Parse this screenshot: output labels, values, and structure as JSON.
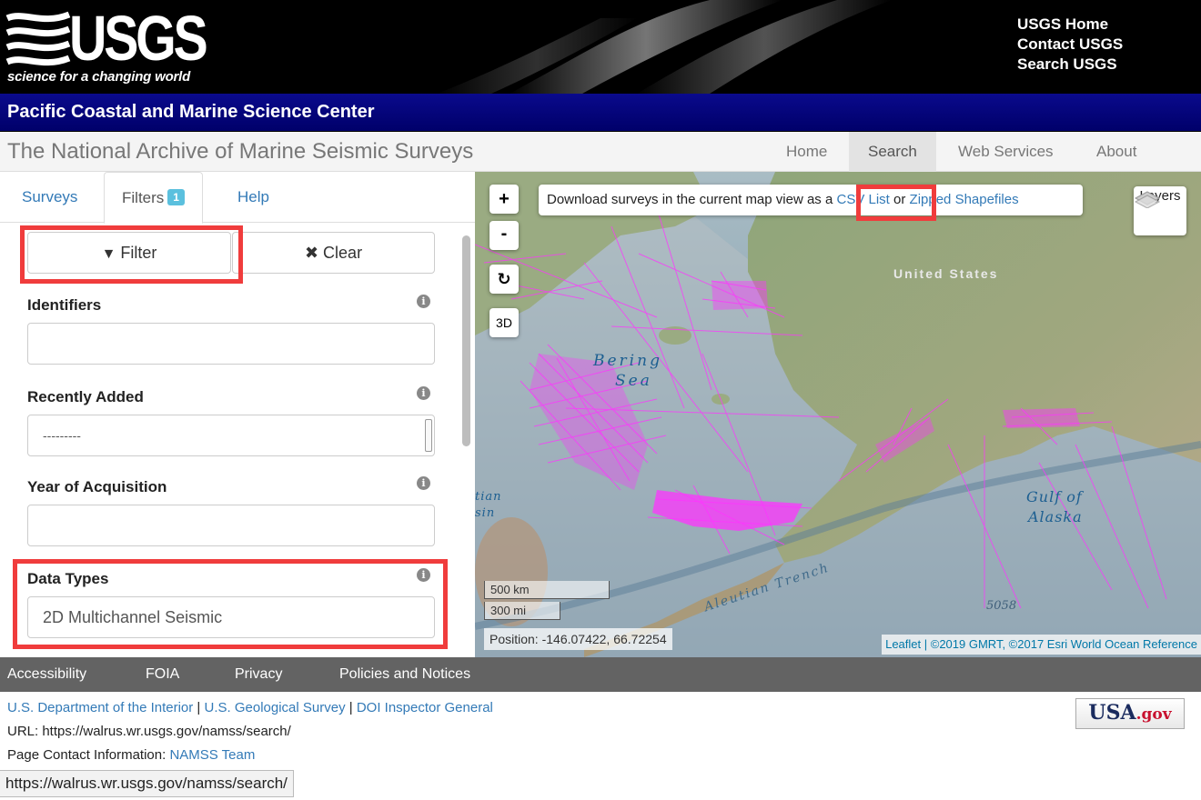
{
  "header": {
    "logo_text": "USGS",
    "tagline": "science for a changing world",
    "links": [
      "USGS Home",
      "Contact USGS",
      "Search USGS"
    ],
    "center_name": "Pacific Coastal and Marine Science Center"
  },
  "nav": {
    "site_title": "The National Archive of Marine Seismic Surveys",
    "items": [
      "Home",
      "Search",
      "Web Services",
      "About"
    ],
    "active": "Search"
  },
  "panel": {
    "tabs": {
      "surveys": "Surveys",
      "filters": "Filters",
      "filters_badge": "1",
      "help": "Help"
    },
    "filter_button": "Filter",
    "clear_button": "Clear",
    "identifiers": {
      "label": "Identifiers",
      "value": ""
    },
    "recently_added": {
      "label": "Recently Added",
      "value": "---------"
    },
    "year": {
      "label": "Year of Acquisition",
      "value": ""
    },
    "data_types": {
      "label": "Data Types",
      "value": "2D Multichannel Seismic"
    }
  },
  "map": {
    "zoom_in": "+",
    "zoom_out": "-",
    "three_d": "3D",
    "download_text": "Download surveys in the current map view as a",
    "csv_link": "CSV List",
    "or_text": "or",
    "shape_link": "Zipped Shapefiles",
    "layers_label": "Layers",
    "scale_km": "500 km",
    "scale_mi": "300 mi",
    "position": "Position: -146.07422, 66.72254",
    "attribution_leaflet": "Leaflet",
    "attribution_rest": " | ©2019 GMRT, ©2017 Esri World Ocean Reference",
    "labels": {
      "bering1": "Bering",
      "bering2": "Sea",
      "us": "United States",
      "gulf1": "Gulf of",
      "gulf2": "Alaska",
      "trench": "Aleutian Trench",
      "aleutian1": "tian",
      "aleutian2": "sin",
      "depth": "5058"
    },
    "colors": {
      "survey_lines": "#ff33ff",
      "highlight": "#f03c3c"
    }
  },
  "footer": {
    "links": [
      "Accessibility",
      "FOIA",
      "Privacy",
      "Policies and Notices"
    ],
    "doi": "U.S. Department of the Interior",
    "usgs": "U.S. Geological Survey",
    "ig": "DOI Inspector General",
    "sep": " | ",
    "url_line": "URL: https://walrus.wr.usgs.gov/namss/search/",
    "contact_prefix": "Page Contact Information: ",
    "contact_link": "NAMSS Team",
    "usagov_a": "USA",
    "usagov_b": ".gov",
    "status_url": "https://walrus.wr.usgs.gov/namss/search/"
  }
}
